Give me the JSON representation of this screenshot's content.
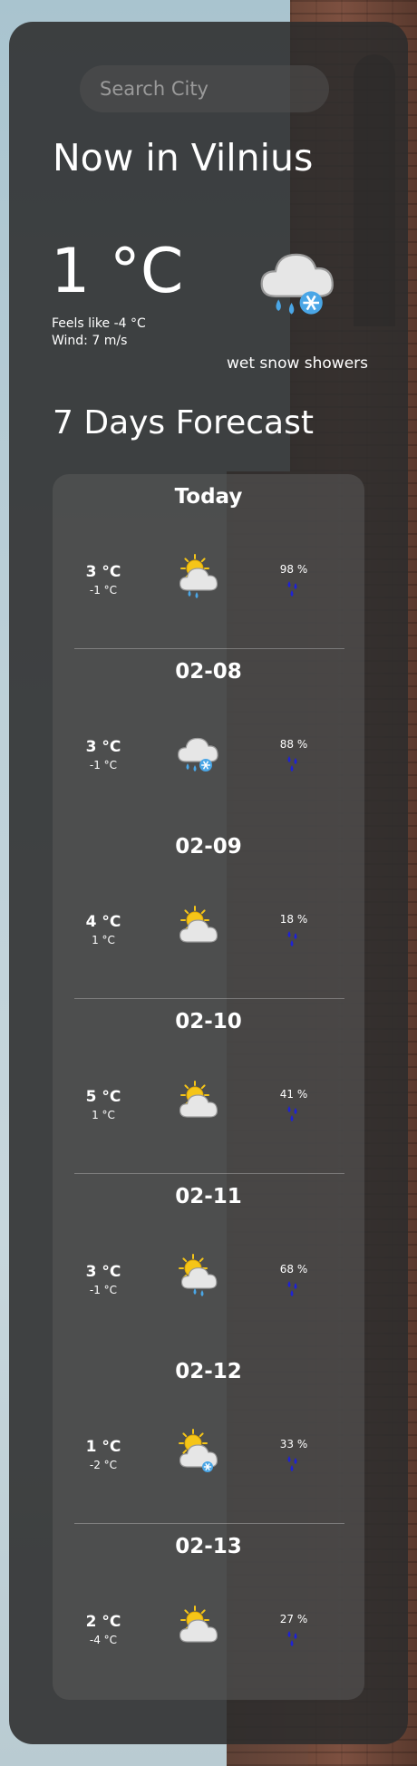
{
  "search": {
    "placeholder": "Search City"
  },
  "current": {
    "title": "Now in Vilnius",
    "temperature": "1 °C",
    "feels_like": "Feels like -4 °C",
    "wind": "Wind: 7 m/s",
    "description": "wet snow showers",
    "icon": "cloud-snow-rain-icon"
  },
  "forecast": {
    "title": "7 Days Forecast",
    "days": [
      {
        "date": "Today",
        "high": "3 °C",
        "low": "-1 °C",
        "precip": "98 %",
        "icon": "sun-cloud-rain-icon"
      },
      {
        "date": "02-08",
        "high": "3 °C",
        "low": "-1 °C",
        "precip": "88 %",
        "icon": "cloud-snow-rain-icon"
      },
      {
        "date": "02-09",
        "high": "4 °C",
        "low": "1 °C",
        "precip": "18 %",
        "icon": "sun-cloud-icon"
      },
      {
        "date": "02-10",
        "high": "5 °C",
        "low": "1 °C",
        "precip": "41 %",
        "icon": "sun-cloud-icon"
      },
      {
        "date": "02-11",
        "high": "3 °C",
        "low": "-1 °C",
        "precip": "68 %",
        "icon": "sun-rain-icon"
      },
      {
        "date": "02-12",
        "high": "1 °C",
        "low": "-2 °C",
        "precip": "33 %",
        "icon": "sun-cloud-snow-icon"
      },
      {
        "date": "02-13",
        "high": "2 °C",
        "low": "-4 °C",
        "precip": "27 %",
        "icon": "sun-cloud-icon"
      }
    ]
  },
  "colors": {
    "drop": "#1e22d6",
    "sun": "#f5c518",
    "cloud": "#e6e6e6",
    "rain": "#4aa6e6"
  }
}
